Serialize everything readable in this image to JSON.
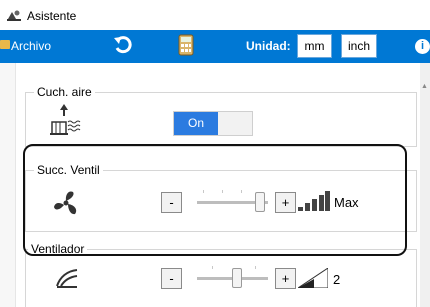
{
  "window": {
    "title": "Asistente"
  },
  "toolbar": {
    "archivo_label": "Archivo",
    "unit_label": "Unidad:",
    "mm_label": "mm",
    "inch_label": "inch",
    "info_label": "i"
  },
  "panels": {
    "air": {
      "title": "Cuch. aire",
      "toggle_label": "On",
      "toggle_state": "on"
    },
    "fan_suction": {
      "title": "Succ. Ventil",
      "minus": "-",
      "plus": "+",
      "value_label": "Max",
      "level": 1.0
    },
    "fan": {
      "title": "Ventilador",
      "minus": "-",
      "plus": "+",
      "value_label": "2",
      "level": 0.5
    }
  }
}
